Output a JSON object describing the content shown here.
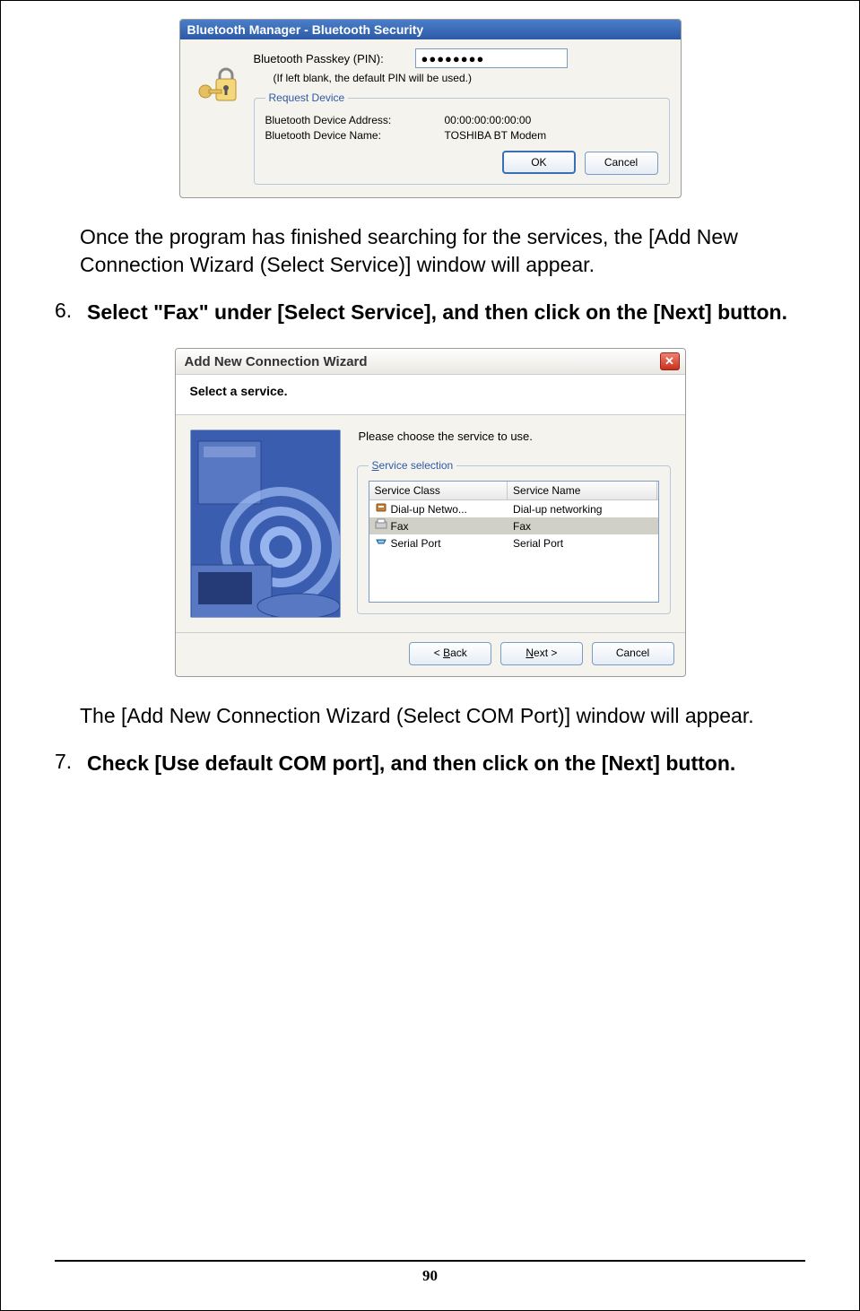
{
  "dialog1": {
    "title": "Bluetooth Manager - Bluetooth Security",
    "passkey_label": "Bluetooth Passkey (PIN):",
    "passkey_value": "●●●●●●●●",
    "note": "(If left blank, the default PIN will be used.)",
    "request_legend": "Request Device",
    "addr_label": "Bluetooth Device Address:",
    "addr_value": "00:00:00:00:00:00",
    "name_label": "Bluetooth Device Name:",
    "name_value": "TOSHIBA BT Modem",
    "ok": "OK",
    "cancel": "Cancel"
  },
  "para1": "Once the program has finished searching for the services, the [Add New Connection Wizard (Select Service)] window will appear.",
  "step6_num": "6.",
  "step6_text": "Select \"Fax\" under [Select Service], and then click on the [Next] button.",
  "dialog2": {
    "title": "Add New Connection Wizard",
    "sub": "Select a service.",
    "instruct": "Please choose the service to use.",
    "legend_u": "S",
    "legend_rest": "ervice selection",
    "col1": "Service Class",
    "col2": "Service Name",
    "rows": [
      {
        "c1": "Dial-up Netwo...",
        "c2": "Dial-up networking",
        "icon": "dialup"
      },
      {
        "c1": "Fax",
        "c2": "Fax",
        "icon": "fax",
        "selected": true
      },
      {
        "c1": "Serial Port",
        "c2": "Serial Port",
        "icon": "serial"
      }
    ],
    "back_u": "B",
    "back_rest": "ack",
    "next_u": "N",
    "next_rest": "ext >",
    "cancel": "Cancel"
  },
  "para2": "The [Add New Connection Wizard (Select COM Port)] window will appear.",
  "step7_num": "7.",
  "step7_text": "Check [Use default COM port], and then click on the [Next] button.",
  "page_number": "90"
}
